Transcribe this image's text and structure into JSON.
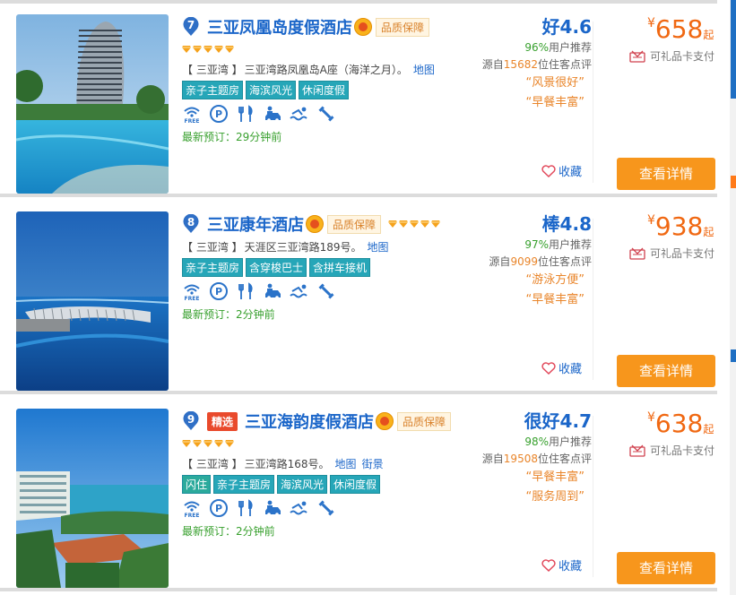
{
  "hotels": [
    {
      "rank": "7",
      "select_label": "",
      "name": "三亚凤凰岛度假酒店",
      "quality_label": "品质保障",
      "diamonds": 5,
      "diamonds_inline": false,
      "area": "【 三亚湾 】",
      "address": "三亚湾路凤凰岛A座（海洋之月）。",
      "map_label": "地图",
      "street_label": "",
      "tags": [
        "亲子主题房",
        "海滨风光",
        "休闲度假"
      ],
      "recent_booking": "最新预订：29分钟前",
      "score": "好4.6",
      "recommend_pct": "96%",
      "recommend_text": "用户推荐",
      "reviews_prefix": "源自",
      "reviews_count": "15682",
      "reviews_suffix": "位住客点评",
      "quotes": [
        "“风景很好”",
        "“早餐丰富”"
      ],
      "favorite_label": "收藏",
      "price_currency": "¥",
      "price": "658",
      "price_suffix": "起",
      "giftcard_label": "可礼品卡支付",
      "detail_label": "查看详情"
    },
    {
      "rank": "8",
      "select_label": "",
      "name": "三亚康年酒店",
      "quality_label": "品质保障",
      "diamonds": 5,
      "diamonds_inline": true,
      "area": "【 三亚湾 】",
      "address": "天涯区三亚湾路189号。",
      "map_label": "地图",
      "street_label": "",
      "tags": [
        "亲子主题房",
        "含穿梭巴士",
        "含拼车接机"
      ],
      "recent_booking": "最新预订：2分钟前",
      "score": "棒4.8",
      "recommend_pct": "97%",
      "recommend_text": "用户推荐",
      "reviews_prefix": "源自",
      "reviews_count": "9099",
      "reviews_suffix": "位住客点评",
      "quotes": [
        "“游泳方便”",
        "“早餐丰富”"
      ],
      "favorite_label": "收藏",
      "price_currency": "¥",
      "price": "938",
      "price_suffix": "起",
      "giftcard_label": "可礼品卡支付",
      "detail_label": "查看详情"
    },
    {
      "rank": "9",
      "select_label": "精选",
      "name": "三亚海韵度假酒店",
      "quality_label": "品质保障",
      "diamonds": 5,
      "diamonds_inline": false,
      "area": "【 三亚湾 】",
      "address": "三亚湾路168号。",
      "map_label": "地图",
      "street_label": "街景",
      "tags": [
        "闪住",
        "亲子主题房",
        "海滨风光",
        "休闲度假"
      ],
      "recent_booking": "最新预订：2分钟前",
      "score": "很好4.7",
      "recommend_pct": "98%",
      "recommend_text": "用户推荐",
      "reviews_prefix": "源自",
      "reviews_count": "19508",
      "reviews_suffix": "位住客点评",
      "quotes": [
        "“早餐丰富”",
        "“服务周到”"
      ],
      "favorite_label": "收藏",
      "price_currency": "¥",
      "price": "638",
      "price_suffix": "起",
      "giftcard_label": "可礼品卡支付",
      "detail_label": "查看详情"
    }
  ],
  "facility_icons": [
    "wifi-free-icon",
    "parking-icon",
    "restaurant-icon",
    "car-service-icon",
    "swimming-icon",
    "fitness-icon"
  ],
  "wifi_free_label": "FREE",
  "colors": {
    "link_blue": "#1b66c9",
    "price_orange": "#f06812",
    "button_orange": "#f7961c",
    "tag_teal": "#26a6b8",
    "recent_green": "#38a02e"
  }
}
